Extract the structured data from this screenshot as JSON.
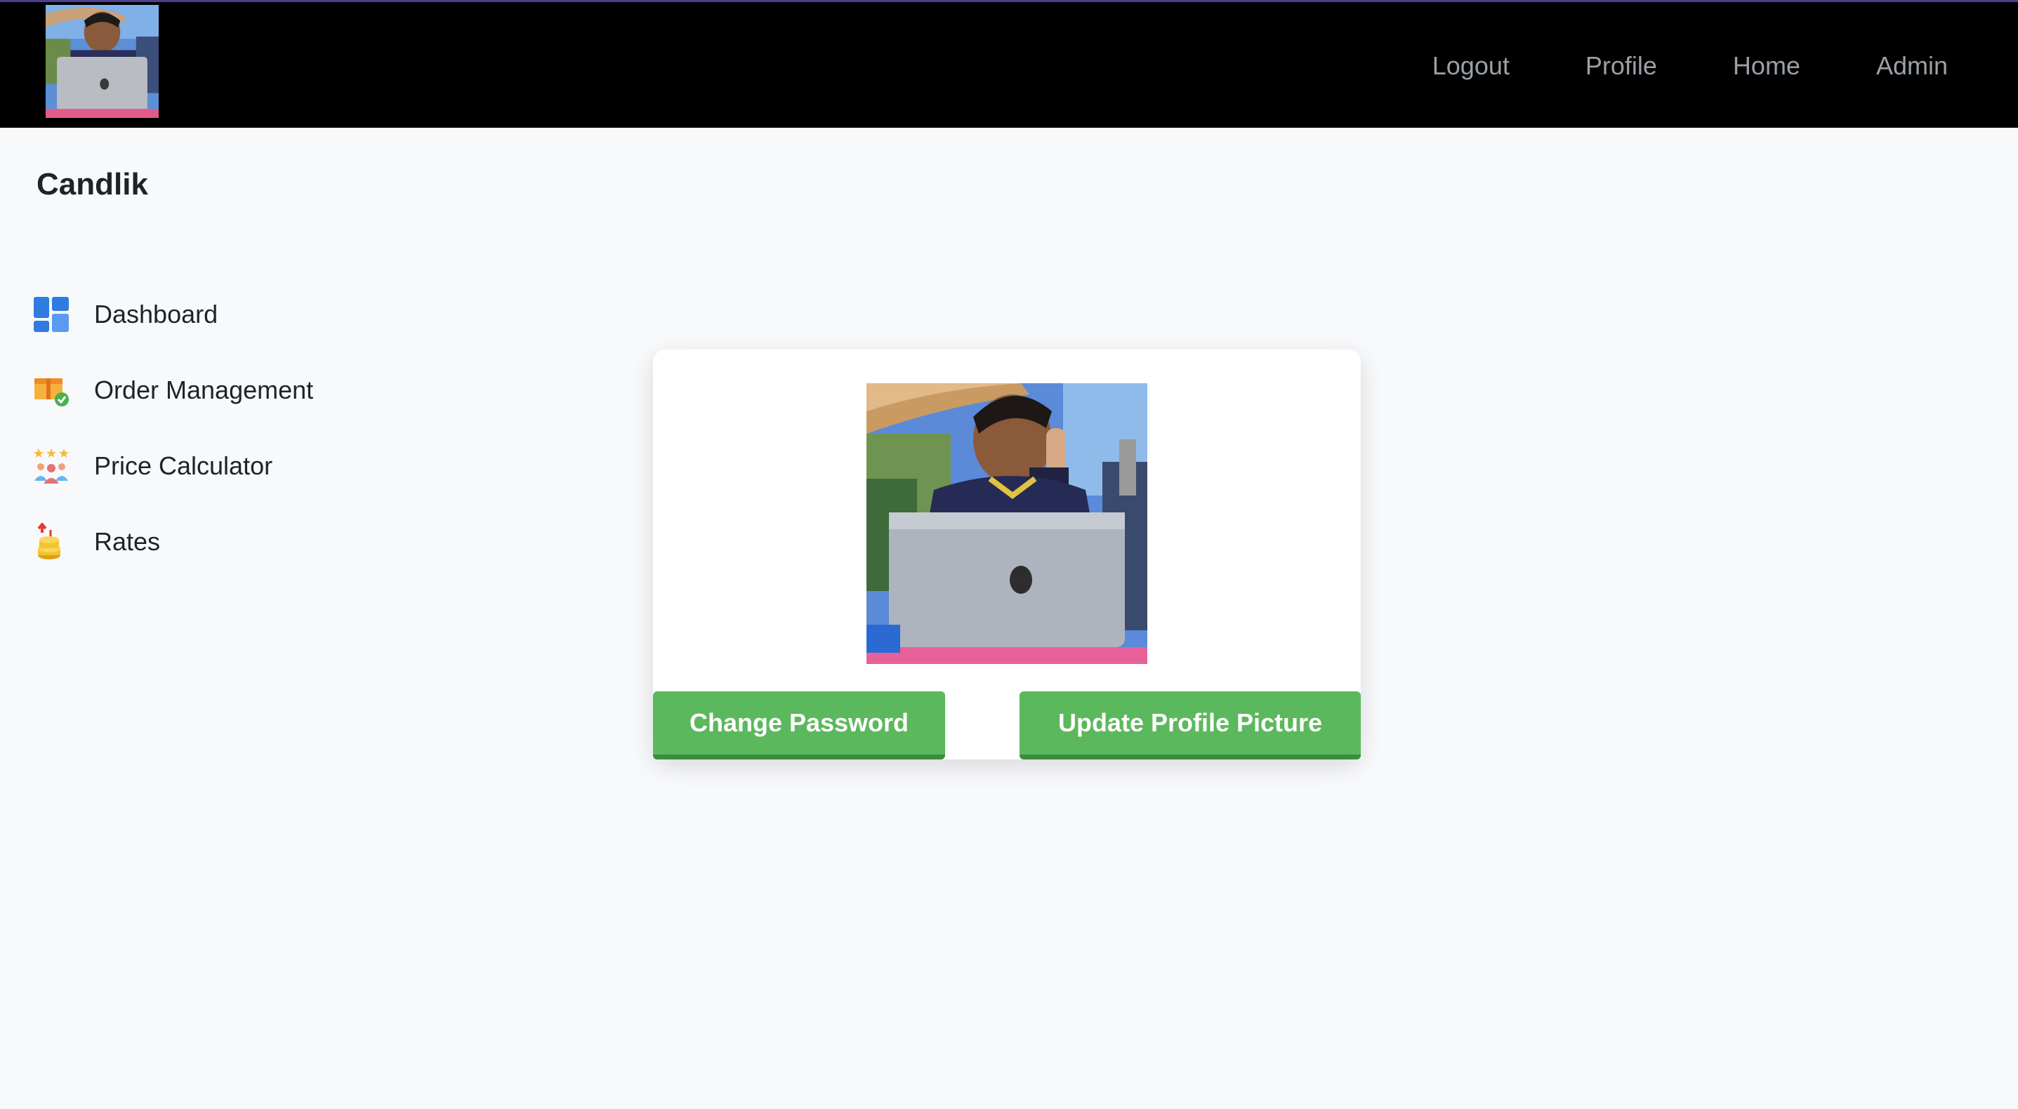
{
  "header": {
    "nav": [
      {
        "label": "Logout"
      },
      {
        "label": "Profile"
      },
      {
        "label": "Home"
      },
      {
        "label": "Admin"
      }
    ]
  },
  "brand": "Candlik",
  "sidebar": {
    "items": [
      {
        "label": "Dashboard",
        "icon": "dashboard-icon"
      },
      {
        "label": "Order Management",
        "icon": "package-icon"
      },
      {
        "label": "Price Calculator",
        "icon": "team-rating-icon"
      },
      {
        "label": "Rates",
        "icon": "coins-icon"
      }
    ]
  },
  "profile": {
    "buttons": {
      "change_password": "Change Password",
      "update_picture": "Update Profile Picture"
    }
  },
  "colors": {
    "topbar": "#000000",
    "nav_text": "#9aa0a6",
    "button": "#5cb85c",
    "button_border": "#3d8b40",
    "page_bg": "#f8f9fb"
  }
}
